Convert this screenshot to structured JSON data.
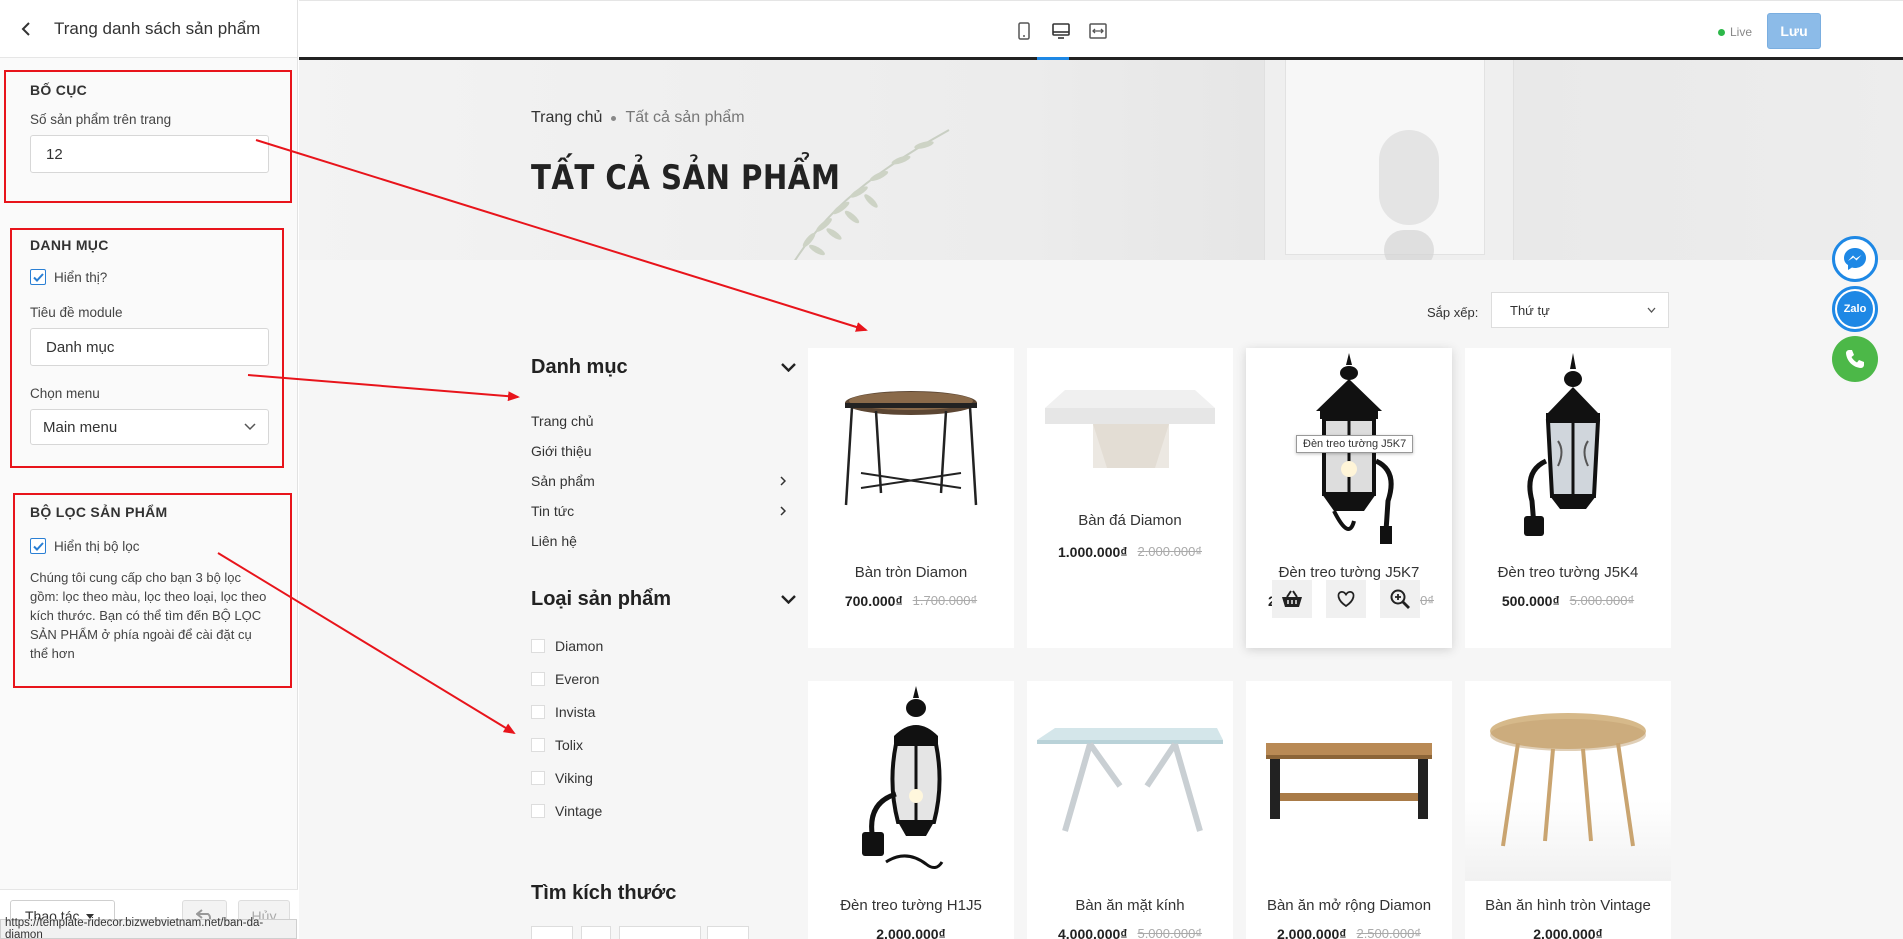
{
  "sidebar": {
    "title": "Trang danh sách sản phẩm",
    "layout": {
      "title": "BỐ CỤC",
      "per_page_label": "Số sản phẩm trên trang",
      "per_page_value": "12"
    },
    "category": {
      "title": "DANH MỤC",
      "show_label": "Hiển thị?",
      "module_title_label": "Tiêu đề module",
      "module_title_value": "Danh mục",
      "menu_label": "Chọn menu",
      "menu_value": "Main menu"
    },
    "filter": {
      "title": "BỘ LỌC SẢN PHẨM",
      "show_label": "Hiển thị bộ lọc",
      "description": "Chúng tôi cung cấp cho bạn 3 bộ lọc gồm: lọc theo màu, lọc theo loại, lọc theo kích thước. Bạn có thể tìm đến BỘ LỌC SẢN PHẨM ở phía ngoài để cài đặt cụ thể hơn"
    },
    "footer": {
      "actions_label": "Thao tác",
      "cancel_label": "Hủy",
      "status_url": "https://template-ridecor.bizwebvietnam.net/ban-da-diamon"
    }
  },
  "topbar": {
    "live_label": "Live",
    "save_label": "Lưu",
    "accent": "#1e88e5"
  },
  "preview": {
    "breadcrumb": {
      "home": "Trang chủ",
      "current": "Tất cả sản phẩm"
    },
    "page_title": "TẤT CẢ SẢN PHẨM",
    "sort": {
      "label": "Sắp xếp:",
      "value": "Thứ tự"
    },
    "categories": {
      "title": "Danh mục",
      "items": [
        {
          "label": "Trang chủ",
          "has_children": false
        },
        {
          "label": "Giới thiệu",
          "has_children": false
        },
        {
          "label": "Sản phẩm",
          "has_children": true
        },
        {
          "label": "Tin tức",
          "has_children": true
        },
        {
          "label": "Liên hệ",
          "has_children": false
        }
      ]
    },
    "product_types": {
      "title": "Loại sản phẩm",
      "items": [
        "Diamon",
        "Everon",
        "Invista",
        "Tolix",
        "Viking",
        "Vintage"
      ]
    },
    "sizes": {
      "title": "Tìm kích thước"
    },
    "products": [
      {
        "name": "Bàn tròn Diamon",
        "price": "700.000₫",
        "old_price": "1.700.000₫"
      },
      {
        "name": "Bàn đá Diamon",
        "price": "1.000.000₫",
        "old_price": "2.000.000₫"
      },
      {
        "name": "Đèn treo tường J5K7",
        "price": "2",
        "old_price": ".000₫",
        "tooltip": "Đèn treo tường J5K7"
      },
      {
        "name": "Đèn treo tường J5K4",
        "price": "500.000₫",
        "old_price": "5.000.000₫"
      },
      {
        "name": "Đèn treo tường H1J5",
        "price": "2.000.000₫",
        "old_price": ""
      },
      {
        "name": "Bàn ăn mặt kính",
        "price": "4.000.000₫",
        "old_price": "5.000.000₫"
      },
      {
        "name": "Bàn ăn mở rộng Diamon",
        "price": "2.000.000₫",
        "old_price": "2.500.000₫"
      },
      {
        "name": "Bàn ăn hình tròn Vintage",
        "price": "2.000.000₫",
        "old_price": ""
      }
    ],
    "floating": {
      "zalo_label": "Zalo",
      "messenger_color": "#1e88e5",
      "zalo_color": "#1e88e5",
      "phone_color": "#4cb848"
    }
  }
}
